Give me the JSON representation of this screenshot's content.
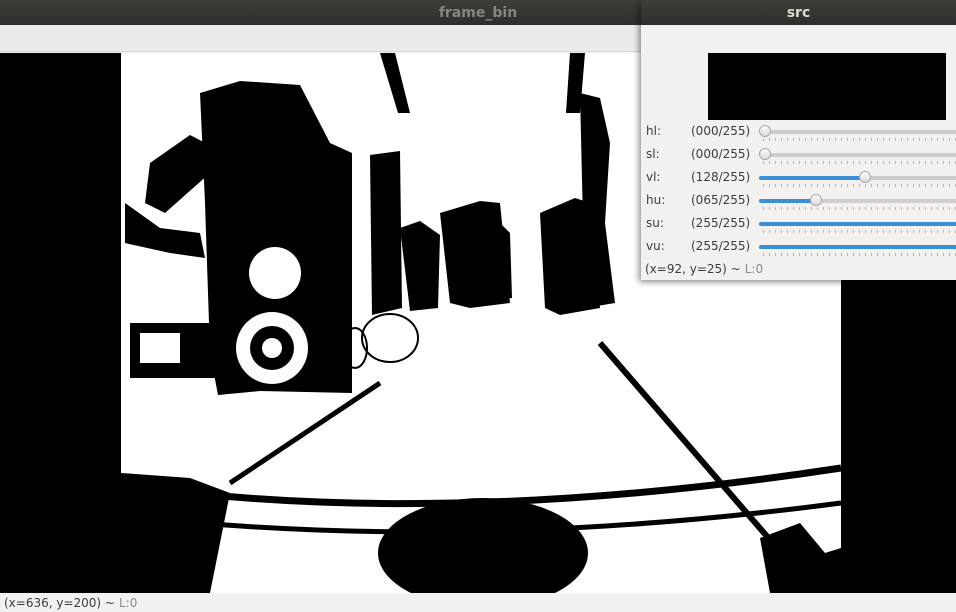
{
  "main_window": {
    "title": "frame_bin",
    "status": {
      "coords": "(x=636, y=200) ~",
      "layer": "L:0"
    }
  },
  "src_window": {
    "title": "src",
    "trackbars": [
      {
        "name": "hl:",
        "value_text": "(000/255)",
        "value": 0,
        "max": 255
      },
      {
        "name": "sl:",
        "value_text": "(000/255)",
        "value": 0,
        "max": 255
      },
      {
        "name": "vl:",
        "value_text": "(128/255)",
        "value": 128,
        "max": 255
      },
      {
        "name": "hu:",
        "value_text": "(065/255)",
        "value": 65,
        "max": 255
      },
      {
        "name": "su:",
        "value_text": "(255/255)",
        "value": 255,
        "max": 255
      },
      {
        "name": "vu:",
        "value_text": "(255/255)",
        "value": 255,
        "max": 255
      }
    ],
    "status": {
      "coords": "(x=92, y=25) ~",
      "layer": "L:0"
    }
  },
  "colors": {
    "slider_fill": "#3c8fd6",
    "titlebar": "#3e3d39"
  }
}
